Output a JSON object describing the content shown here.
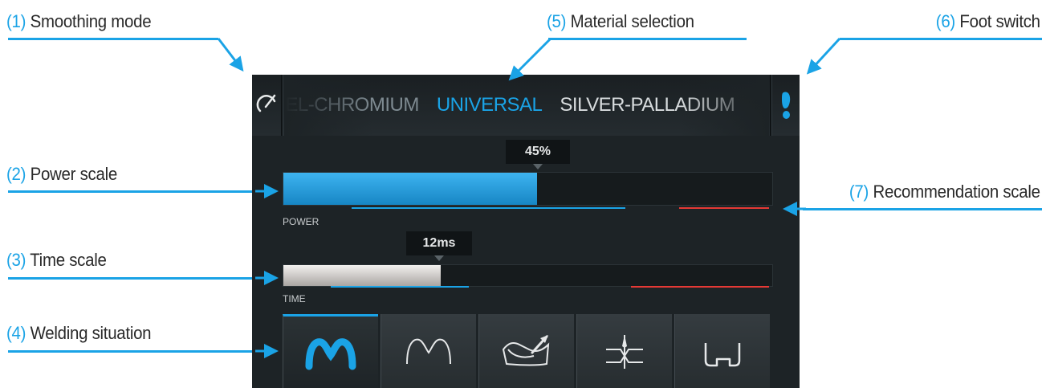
{
  "callouts": [
    {
      "num": "(1)",
      "label": "Smoothing mode"
    },
    {
      "num": "(2)",
      "label": "Power scale"
    },
    {
      "num": "(3)",
      "label": "Time scale"
    },
    {
      "num": "(4)",
      "label": "Welding situation"
    },
    {
      "num": "(5)",
      "label": "Material selection"
    },
    {
      "num": "(6)",
      "label": "Foot switch"
    },
    {
      "num": "(7)",
      "label": "Recommendation scale"
    }
  ],
  "materials": {
    "items": [
      "NICKEL-CHROMIUM",
      "UNIVERSAL",
      "SILVER-PALLADIUM"
    ],
    "selected": "UNIVERSAL"
  },
  "power": {
    "label": "POWER",
    "value_text": "45%",
    "fill_fraction": 0.45
  },
  "time": {
    "label": "TIME",
    "value_text": "12ms",
    "fill_fraction": 0.31
  },
  "recommendation": {
    "good_color": "#1aa3e6",
    "bad_color": "#e53935"
  },
  "situations": [
    {
      "icon": "m-shape-bold-icon",
      "active": true
    },
    {
      "icon": "m-shape-outline-icon",
      "active": false
    },
    {
      "icon": "bridge-weld-icon",
      "active": false
    },
    {
      "icon": "joint-weld-icon",
      "active": false
    },
    {
      "icon": "clasp-weld-icon",
      "active": false
    }
  ],
  "colors": {
    "accent": "#1aa3e6",
    "screen_bg": "#1d2326",
    "warning": "#e53935"
  }
}
